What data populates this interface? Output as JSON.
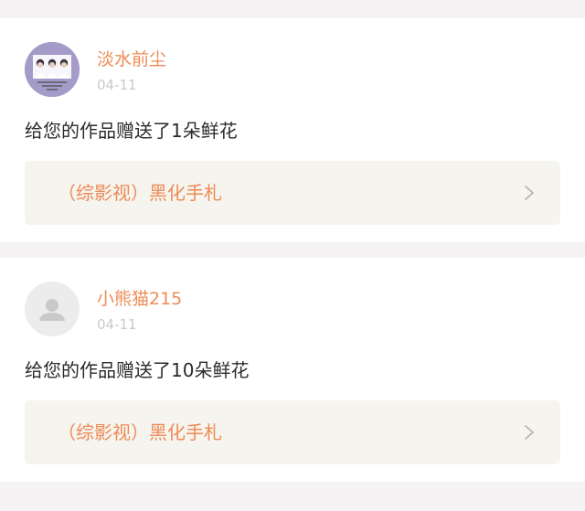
{
  "notifications": [
    {
      "username": "淡水前尘",
      "date": "04-11",
      "message": "给您的作品赠送了1朵鲜花",
      "work_title": "（综影视）黑化手札",
      "avatar_icon": "user-photo-avatar"
    },
    {
      "username": "小熊猫215",
      "date": "04-11",
      "message": "给您的作品赠送了10朵鲜花",
      "work_title": "（综影视）黑化手札",
      "avatar_icon": "default-user-avatar"
    }
  ],
  "colors": {
    "accent": "#ed8b55",
    "page_background": "#f5f3f4",
    "card_background": "#ffffff",
    "link_background": "#f6f4ef",
    "date_text": "#c9c9c9",
    "body_text": "#2b2b2b"
  }
}
